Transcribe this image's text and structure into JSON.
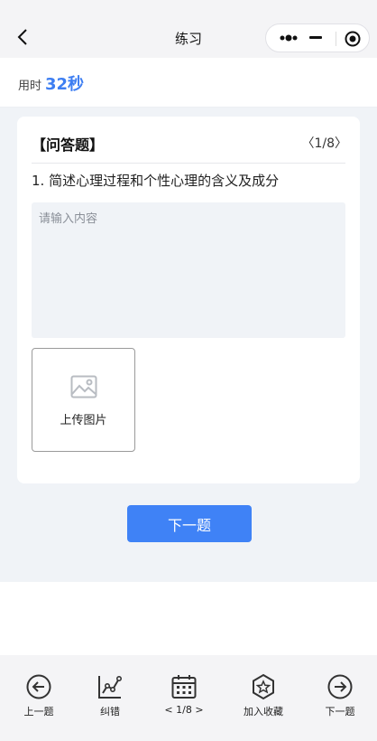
{
  "nav": {
    "title": "练习"
  },
  "timer": {
    "label": "用时",
    "value": "32秒"
  },
  "question": {
    "type_label": "【问答题】",
    "pager": "〈1/8〉",
    "text": "1. 简述心理过程和个性心理的含义及成分",
    "answer_value": "",
    "answer_placeholder": "请输入内容",
    "upload_label": "上传图片"
  },
  "next_button": {
    "label": "下一题"
  },
  "tabbar": {
    "items": [
      {
        "label": "上一题",
        "icon": "arrow-left-circle-icon"
      },
      {
        "label": "纠错",
        "icon": "chart-correction-icon"
      },
      {
        "label": "< 1/8 >",
        "icon": "calendar-icon"
      },
      {
        "label": "加入收藏",
        "icon": "star-hexagon-icon"
      },
      {
        "label": "下一题",
        "icon": "arrow-right-circle-icon"
      }
    ]
  },
  "colors": {
    "accent": "#3f82f6",
    "timer": "#3d7ef2",
    "background": "#f0f3f7"
  }
}
